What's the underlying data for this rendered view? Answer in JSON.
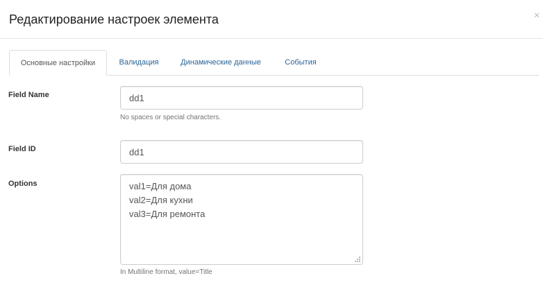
{
  "modal": {
    "title": "Редактирование настроек элемента",
    "close_label": "×"
  },
  "tabs": [
    {
      "label": "Основные настройки",
      "active": true
    },
    {
      "label": "Валидация",
      "active": false
    },
    {
      "label": "Динамические данные",
      "active": false
    },
    {
      "label": "События",
      "active": false
    }
  ],
  "fields": {
    "field_name": {
      "label": "Field Name",
      "value": "dd1",
      "help": "No spaces or special characters."
    },
    "field_id": {
      "label": "Field ID",
      "value": "dd1"
    },
    "options": {
      "label": "Options",
      "value": "val1=Для дома\nval2=Для кухни\nval3=Для ремонта",
      "help": "In Multiline format, value=Title"
    }
  },
  "colors": {
    "link": "#2a6496",
    "border": "#dddddd",
    "input_border": "#cccccc",
    "help_text": "#737373"
  },
  "icons": {
    "close": "close-icon",
    "resize": "resize-grip-icon"
  }
}
